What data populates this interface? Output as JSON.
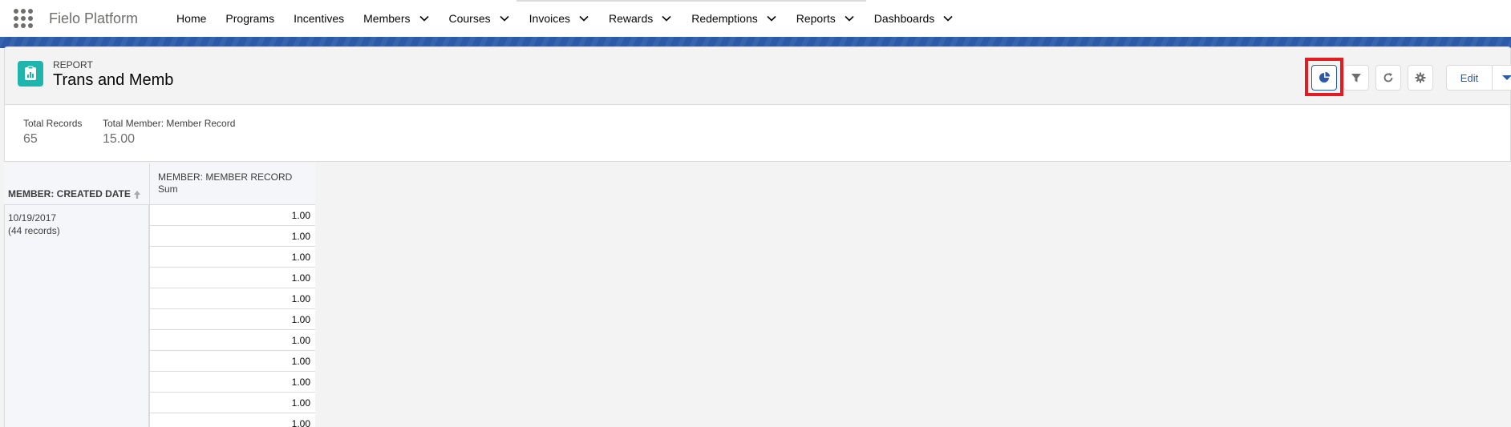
{
  "app": {
    "name": "Fielo Platform",
    "nav": [
      {
        "label": "Home",
        "menu": false
      },
      {
        "label": "Programs",
        "menu": false
      },
      {
        "label": "Incentives",
        "menu": false
      },
      {
        "label": "Members",
        "menu": true
      },
      {
        "label": "Courses",
        "menu": true
      },
      {
        "label": "Invoices",
        "menu": true
      },
      {
        "label": "Rewards",
        "menu": true
      },
      {
        "label": "Redemptions",
        "menu": true
      },
      {
        "label": "Reports",
        "menu": true
      },
      {
        "label": "Dashboards",
        "menu": true
      }
    ]
  },
  "header": {
    "eyebrow": "REPORT",
    "title": "Trans and Memb",
    "edit_label": "Edit",
    "icons": [
      "chart-icon",
      "filter-icon",
      "refresh-icon",
      "gear-icon",
      "chevron-down-icon"
    ]
  },
  "summary": {
    "total_records_label": "Total Records",
    "total_records_value": "65",
    "total_member_label": "Total Member: Member Record",
    "total_member_value": "15.00"
  },
  "table": {
    "group_header": "MEMBER: CREATED DATE",
    "value_header": "MEMBER: MEMBER RECORD",
    "value_subheader": "Sum",
    "group_date": "10/19/2017",
    "group_count": "(44 records)",
    "rows": [
      "1.00",
      "1.00",
      "1.00",
      "1.00",
      "1.00",
      "1.00",
      "1.00",
      "1.00",
      "1.00",
      "1.00",
      "1.00"
    ]
  },
  "colors": {
    "brand": "#2c5aa8",
    "report_icon": "#1fb5ad",
    "annotation": "#e21c23"
  }
}
